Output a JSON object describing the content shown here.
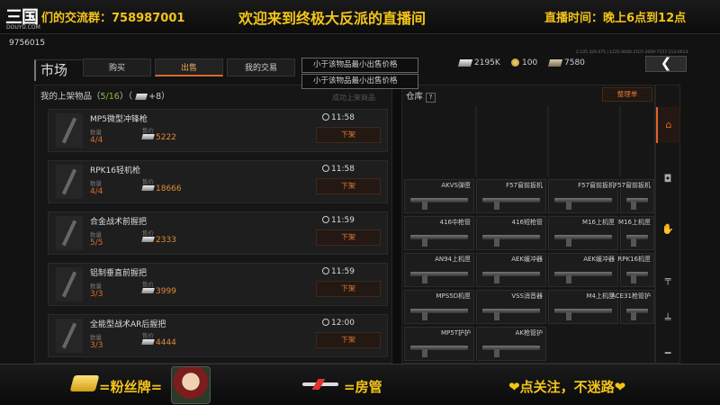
{
  "overlay_top": {
    "logo": "三国",
    "logo_sub": "DOUYU.COM",
    "qq_group": "们的交流群：758987001",
    "welcome": "欢迎来到终极大反派的直播间",
    "live_time": "直播时间：晚上6点到12点"
  },
  "game": {
    "uid": "9756015",
    "version": "2.105.329.075 | 1225-0640-2107-2009-7157-113-0013",
    "title": "市场",
    "tabs": [
      {
        "label": "购买",
        "active": false
      },
      {
        "label": "出售",
        "active": true
      },
      {
        "label": "我的交易",
        "active": false
      }
    ],
    "dropdown": [
      "小于该物品最小出售价格",
      "小于该物品最小出售价格"
    ],
    "currencies": [
      {
        "icon": "silver-bar-icon",
        "value": "2195K"
      },
      {
        "icon": "coin-icon",
        "value": "100"
      },
      {
        "icon": "gold-bar-icon",
        "value": "7580"
      }
    ],
    "back_label": "❮",
    "listed": {
      "prefix": "我的上架物品（",
      "count": "5/16",
      "mid": "）（",
      "bonus": "+8",
      "suffix": "）",
      "sold_off_label": "成功上架商品",
      "qty_label": "数量",
      "price_label": "售价",
      "off_label": "下架",
      "items": [
        {
          "name": "MP5微型冲锋枪",
          "qty": "4/4",
          "price": "5222",
          "time": "11:58"
        },
        {
          "name": "RPK16轻机枪",
          "qty": "4/4",
          "price": "18666",
          "time": "11:58"
        },
        {
          "name": "合金战术前握把",
          "qty": "5/5",
          "price": "2333",
          "time": "11:59"
        },
        {
          "name": "铝制垂直前握把",
          "qty": "3/3",
          "price": "3999",
          "time": "11:59"
        },
        {
          "name": "全能型战术AR后握把",
          "qty": "3/3",
          "price": "4444",
          "time": "12:00"
        }
      ]
    },
    "warehouse": {
      "title": "仓库",
      "help": "?",
      "button": "整理单",
      "cells": [
        "AKVS弹匣",
        "F57窗前扳机",
        "F57窗前扳机",
        "F57窗前扳机",
        "416中枪管",
        "416短枪管",
        "M16上机匣",
        "M16上机匣",
        "AN94上机匣",
        "AEK缓冲器",
        "AEK缓冲器",
        "RPK16机匣",
        "MPS5D机匣",
        "VSS消音器",
        "M4上机匣",
        "ACE31枪管护",
        "MP5T护护",
        "AK枪管护"
      ]
    },
    "side_tabs": [
      "⌂",
      "◘",
      "✋",
      "╤",
      "╧",
      "━"
    ]
  },
  "overlay_bottom": {
    "fans_label": "=粉丝牌=",
    "mods_label": "=房管",
    "follow_label": "❤点关注，不迷路❤"
  },
  "colors": {
    "accent": "#e0632a",
    "overlay_yellow": "#f3c419",
    "qty_orange": "#d96f2a"
  }
}
